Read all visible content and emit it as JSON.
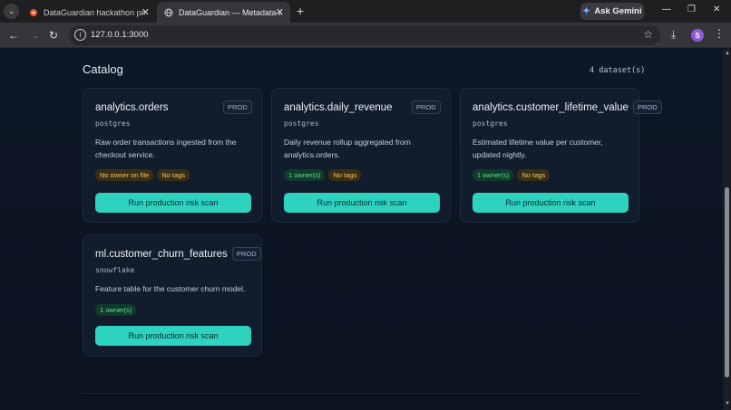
{
  "browser": {
    "tabs": [
      {
        "title": "DataGuardian hackathon proje",
        "active": false,
        "icon": "hackathon-favicon"
      },
      {
        "title": "DataGuardian — Metadata-Awa",
        "active": true,
        "icon": "globe-icon"
      }
    ],
    "tab_list_icon": "chevron-down-icon",
    "new_tab_icon": "plus-icon",
    "gemini_label": "Ask Gemini",
    "url": "127.0.0.1:3000",
    "profile_initial": "S",
    "accent": "#8e5bd6"
  },
  "catalog": {
    "title": "Catalog",
    "count": "4 dataset(s)"
  },
  "datasets": [
    {
      "name": "analytics.orders",
      "env": "PROD",
      "platform": "postgres",
      "description": "Raw order transactions ingested from the checkout service.",
      "chips": [
        {
          "label": "No owner on file",
          "kind": "warn"
        },
        {
          "label": "No tags",
          "kind": "warn"
        }
      ],
      "button": "Run production risk scan"
    },
    {
      "name": "analytics.daily_revenue",
      "env": "PROD",
      "platform": "postgres",
      "description": "Daily revenue rollup aggregated from analytics.orders.",
      "chips": [
        {
          "label": "1 owner(s)",
          "kind": "ok"
        },
        {
          "label": "No tags",
          "kind": "warn"
        }
      ],
      "button": "Run production risk scan"
    },
    {
      "name": "analytics.customer_lifetime_value",
      "env": "PROD",
      "platform": "postgres",
      "description": "Estimated lifetime value per customer, updated nightly.",
      "chips": [
        {
          "label": "1 owner(s)",
          "kind": "ok"
        },
        {
          "label": "No tags",
          "kind": "warn"
        }
      ],
      "button": "Run production risk scan"
    },
    {
      "name": "ml.customer_churn_features",
      "env": "PROD",
      "platform": "snowflake",
      "description": "Feature table for the customer churn model.",
      "chips": [
        {
          "label": "1 owner(s)",
          "kind": "ok"
        }
      ],
      "button": "Run production risk scan"
    }
  ],
  "colors": {
    "button": "#2ed3c0",
    "warn_chip": "#f2c56b",
    "ok_chip": "#5fe0a4",
    "background": "#0b1421"
  }
}
